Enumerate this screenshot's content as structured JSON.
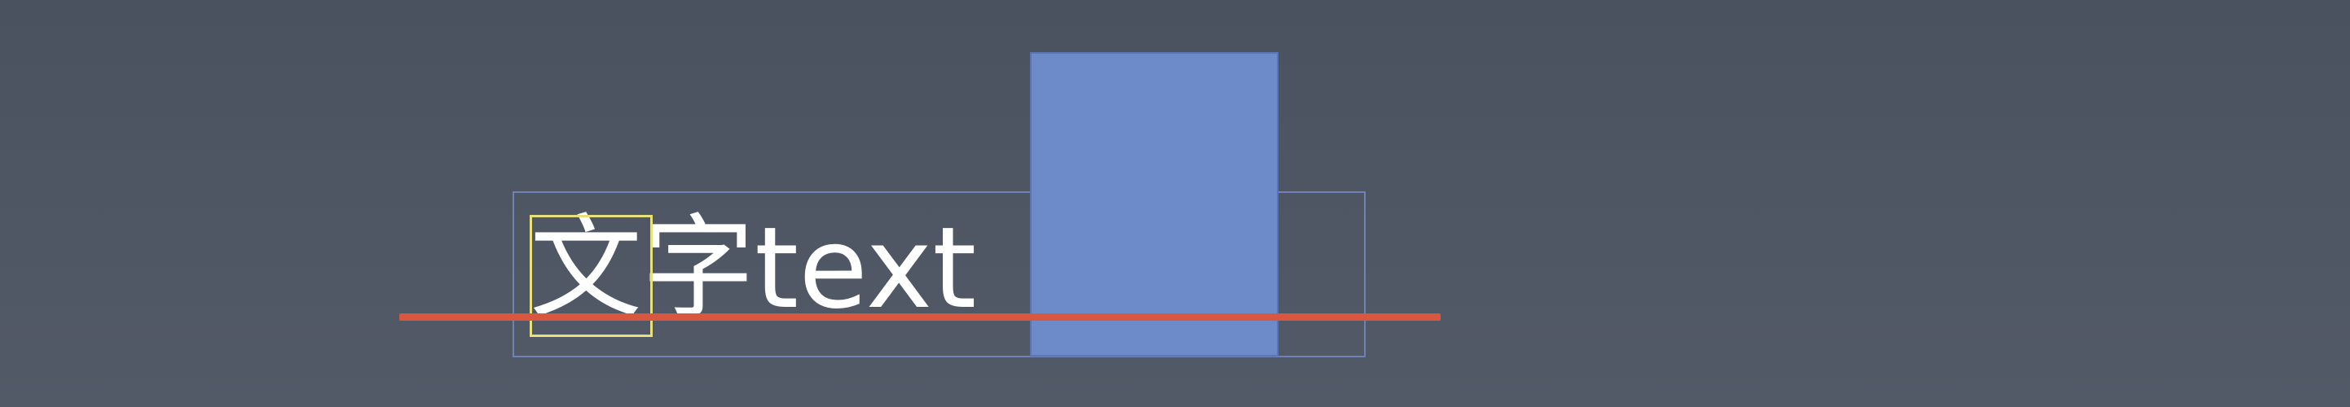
{
  "diagram": {
    "text_run": "文字text",
    "colors": {
      "background": "#4f5663",
      "line_box_border": "#6e82b8",
      "inline_block_fill": "#6d8bc9",
      "glyph_box_border": "#e8e07a",
      "baseline": "#d9573e",
      "text": "#ffffff"
    }
  }
}
